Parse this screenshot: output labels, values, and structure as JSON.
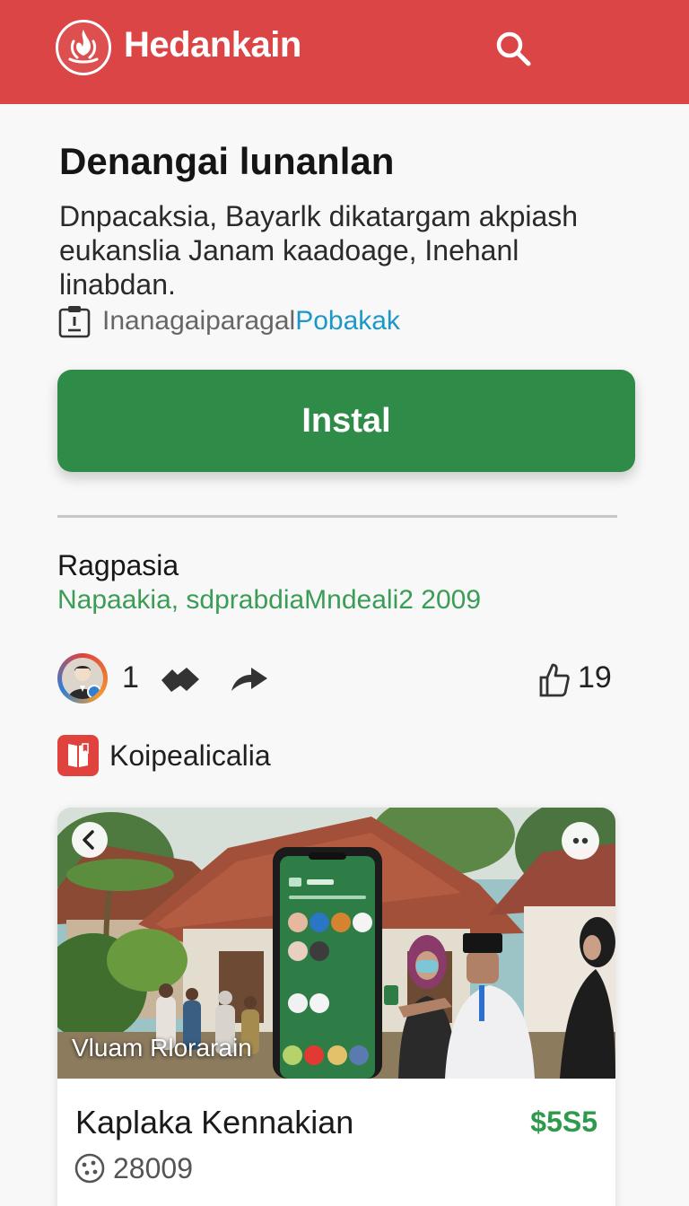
{
  "header": {
    "app_title": "Hedankain",
    "logo_icon": "flame-logo",
    "search_icon": "search-icon"
  },
  "intro": {
    "headline": "Denangai lunanlan",
    "description": "Dnpacaksia, Bayarlk dikatargam akpiash eukanslia Janam kaadoage, Inehanl linabdan.",
    "meta_text": "Inanagaiparagal",
    "meta_link": "Pobakak"
  },
  "install_button": {
    "label": "Instal"
  },
  "section": {
    "title": "Ragpasia",
    "subtitle": "Napaakia, sdprabdiaMndeali2 2009"
  },
  "social": {
    "count": "1",
    "likes": "19"
  },
  "category": {
    "label": "Koipealicalia"
  },
  "card": {
    "image_caption": "Vluam Rlorarain",
    "title": "Kaplaka Kennakian",
    "price": "$5S5",
    "stats": "28009"
  },
  "colors": {
    "header": "#dc4546",
    "install": "#2f8c48",
    "link": "#1c98c7",
    "accent_green": "#3a9c55",
    "price": "#2f9a4c"
  }
}
